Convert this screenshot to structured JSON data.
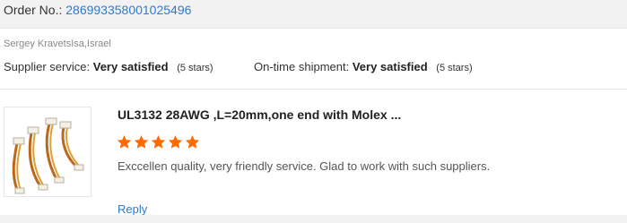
{
  "order": {
    "label": "Order No.:",
    "number": "286993358001025496"
  },
  "buyer": {
    "name_country": "Sergey KravetsIsa,Israel"
  },
  "ratings": {
    "supplier_label": "Supplier service:",
    "supplier_value": "Very satisfied",
    "supplier_stars_text": "(5 stars)",
    "shipment_label": "On-time shipment:",
    "shipment_value": "Very satisfied",
    "shipment_stars_text": "(5 stars)"
  },
  "product": {
    "image_icon": "wire-harness-product-image",
    "title": "UL3132 28AWG ,L=20mm,one end with Molex ...",
    "rating_stars": 5,
    "star_color": "#ff6a00",
    "review": "Exccellen quality, very friendly service. Glad to work with such suppliers."
  },
  "actions": {
    "reply_label": "Reply"
  },
  "colors": {
    "link": "#2e7bcf",
    "header_bg": "#f2f2f2"
  }
}
